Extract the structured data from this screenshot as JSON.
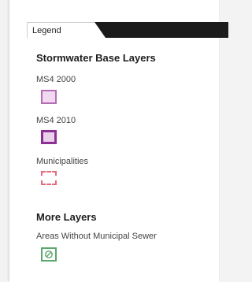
{
  "legend": {
    "tab_label": "Legend"
  },
  "groups": [
    {
      "title": "Stormwater Base Layers",
      "layers": [
        {
          "label": "MS4 2000",
          "fill": "#f1d9f1",
          "stroke": "#b46fb4"
        },
        {
          "label": "MS4 2010",
          "fill": "#ead2ea",
          "stroke": "#8e2f95"
        },
        {
          "label": "Municipalities",
          "fill": "#ffffff",
          "stroke": "#e36a7e"
        }
      ]
    },
    {
      "title": "More Layers",
      "layers": [
        {
          "label": "Areas Without Municipal Sewer",
          "fill": "#ffffff",
          "stroke": "#5aa86a",
          "icon": "no-sewer-hatch-icon"
        }
      ]
    }
  ]
}
